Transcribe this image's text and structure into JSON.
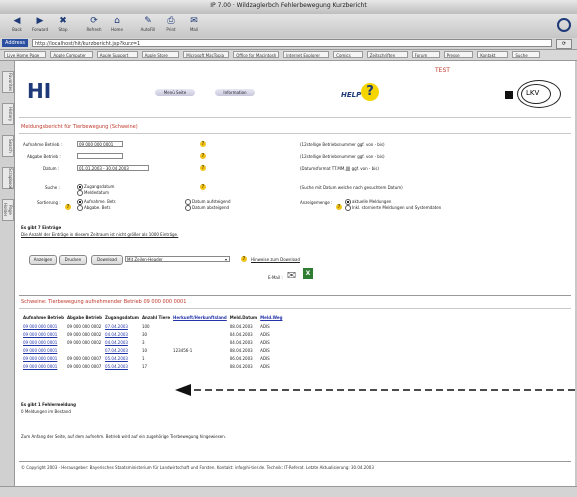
{
  "window": {
    "title": "IP 7.00 · Wildzaglerbch Fehlerbewegung Kurzbericht"
  },
  "toolbar": {
    "buttons": [
      {
        "icon": "back-arrow-icon",
        "glyph": "◀",
        "label": "Back"
      },
      {
        "icon": "forward-arrow-icon",
        "glyph": "▶",
        "label": "Forward"
      },
      {
        "icon": "stop-icon",
        "glyph": "✖",
        "label": "Stop"
      },
      {
        "icon": "refresh-icon",
        "glyph": "⟳",
        "label": "Refresh"
      },
      {
        "icon": "home-icon",
        "glyph": "⌂",
        "label": "Home"
      },
      {
        "icon": "autofill-icon",
        "glyph": "✎",
        "label": "AutoFill"
      },
      {
        "icon": "print-icon",
        "glyph": "⎙",
        "label": "Print"
      },
      {
        "icon": "mail-icon",
        "glyph": "✉",
        "label": "Mail"
      }
    ]
  },
  "address": {
    "label": "Address",
    "value": "http://localhost/hit/kurzbericht.jsp?kurz=1"
  },
  "favorites": [
    "Live Home Page",
    "Apple Computer",
    "Apple Support",
    "Apple Store",
    "Microsoft MacTopia",
    "Office for Macintosh",
    "Internet Explorer",
    "Comics",
    "Zeitschriften",
    "Forum",
    "Presse",
    "Kontakt",
    "Suche"
  ],
  "sidebar": {
    "tabs": [
      "Favorites",
      "History",
      "Search",
      "Scrapbook",
      "Page Holder"
    ]
  },
  "page": {
    "test_label": "TEST",
    "logo_hi": "HI",
    "nav": [
      "Menü Seite",
      "Information"
    ],
    "helpdesk_logo": "HELP",
    "lkv_logo": "LKV",
    "section_title": "Meldungsbericht für Tierbewegung (Schweine)",
    "form": {
      "rows": [
        {
          "label": "Aufnahme Betrieb :",
          "value": "09 000 000 0001",
          "hint": "(12stellige Betriebsnummer ggf. von - bis)"
        },
        {
          "label": "Abgabe Betrieb :",
          "value": "",
          "hint": "(12stellige Betriebsnummer ggf. von - bis)"
        },
        {
          "label": "Datum :",
          "value": "01.01.2003 - 30.04.2003",
          "hint": "(Datumsformat TT.MM.JJJJ ggf. von - bis)"
        }
      ],
      "suche_label": "Suche :",
      "suche_options": [
        "Zugangsdatum",
        "Meldedatum"
      ],
      "suche_hint": "(Suche mit Datum welche nach gesuchtem Datum)",
      "sort_label": "Sortierung :",
      "sort_options": [
        "Aufnahme. Betr.",
        "Abgabe. Betr.",
        "Datum aufsteigend",
        "Datum absteigend"
      ],
      "anzeige_label": "Anzeigemenge :",
      "anzeige_options": [
        "aktuelle Meldungen",
        "Inkl. stornierte Meldungen und Systemdaten"
      ]
    },
    "info_heading": "Es gibt 7 Einträge",
    "info_text": "Die Anzahl der Einträge in diesem Zeitraum ist nicht größer als 1000 Einträge.",
    "buttons": {
      "anzeigen": "Anzeigen",
      "drucken": "Drucken",
      "download": "Download"
    },
    "format_select": "Mit Zeilen-Header",
    "hinweise_link": "Hinweise zum Download",
    "email_label": "E-Mail :",
    "result_title": "Schweine: Tierbewegung aufnehmender Betrieb 09 000 000 0001",
    "table": {
      "headers": [
        "Aufnahme Betrieb",
        "Abgabe Betrieb",
        "Zugangsdatum",
        "Anzahl Tiere",
        "Herkunft/Herkunftsland",
        "Meld.Datum",
        "Meld.Weg"
      ],
      "rows": [
        [
          "09 000 000 0001",
          "09 000 000 0002",
          "07.04.2003",
          "100",
          "",
          "08.04.2003",
          "ADIS"
        ],
        [
          "09 000 000 0001",
          "09 000 000 0002",
          "04.04.2003",
          "30",
          "",
          "04.04.2003",
          "ADIS"
        ],
        [
          "09 000 000 0001",
          "09 000 000 0002",
          "04.04.2003",
          "3",
          "",
          "04.04.2003",
          "ADIS"
        ],
        [
          "09 000 000 0001",
          "",
          "07.04.2003",
          "10",
          "123456-1",
          "08.04.2003",
          "ADIS"
        ],
        [
          "09 000 000 0001",
          "09 000 000 0007",
          "05.04.2003",
          "1",
          "",
          "06.04.2003",
          "ADIS"
        ],
        [
          "09 000 000 0001",
          "09 000 000 0007",
          "05.04.2003",
          "17",
          "",
          "08.04.2003",
          "ADIS"
        ]
      ]
    },
    "footnote_heading": "Es gibt 1 Fehlermeldung",
    "footnote_text": "0 Meldungen im Bestand",
    "bottom_note": "Zum Anfang der Seite, auf dem aufnehm. Betrieb wird auf ein zugehörige Tierbewegung hingewiesen.",
    "footer": "© Copyright 2003 - Herausgeber: Bayerisches Staatsministerium für Landwirtschaft und Forsten. Kontakt: info@hi-tier.de. Technik: IT-Referat. Letzte Aktualisierung: 30.04.2003"
  }
}
